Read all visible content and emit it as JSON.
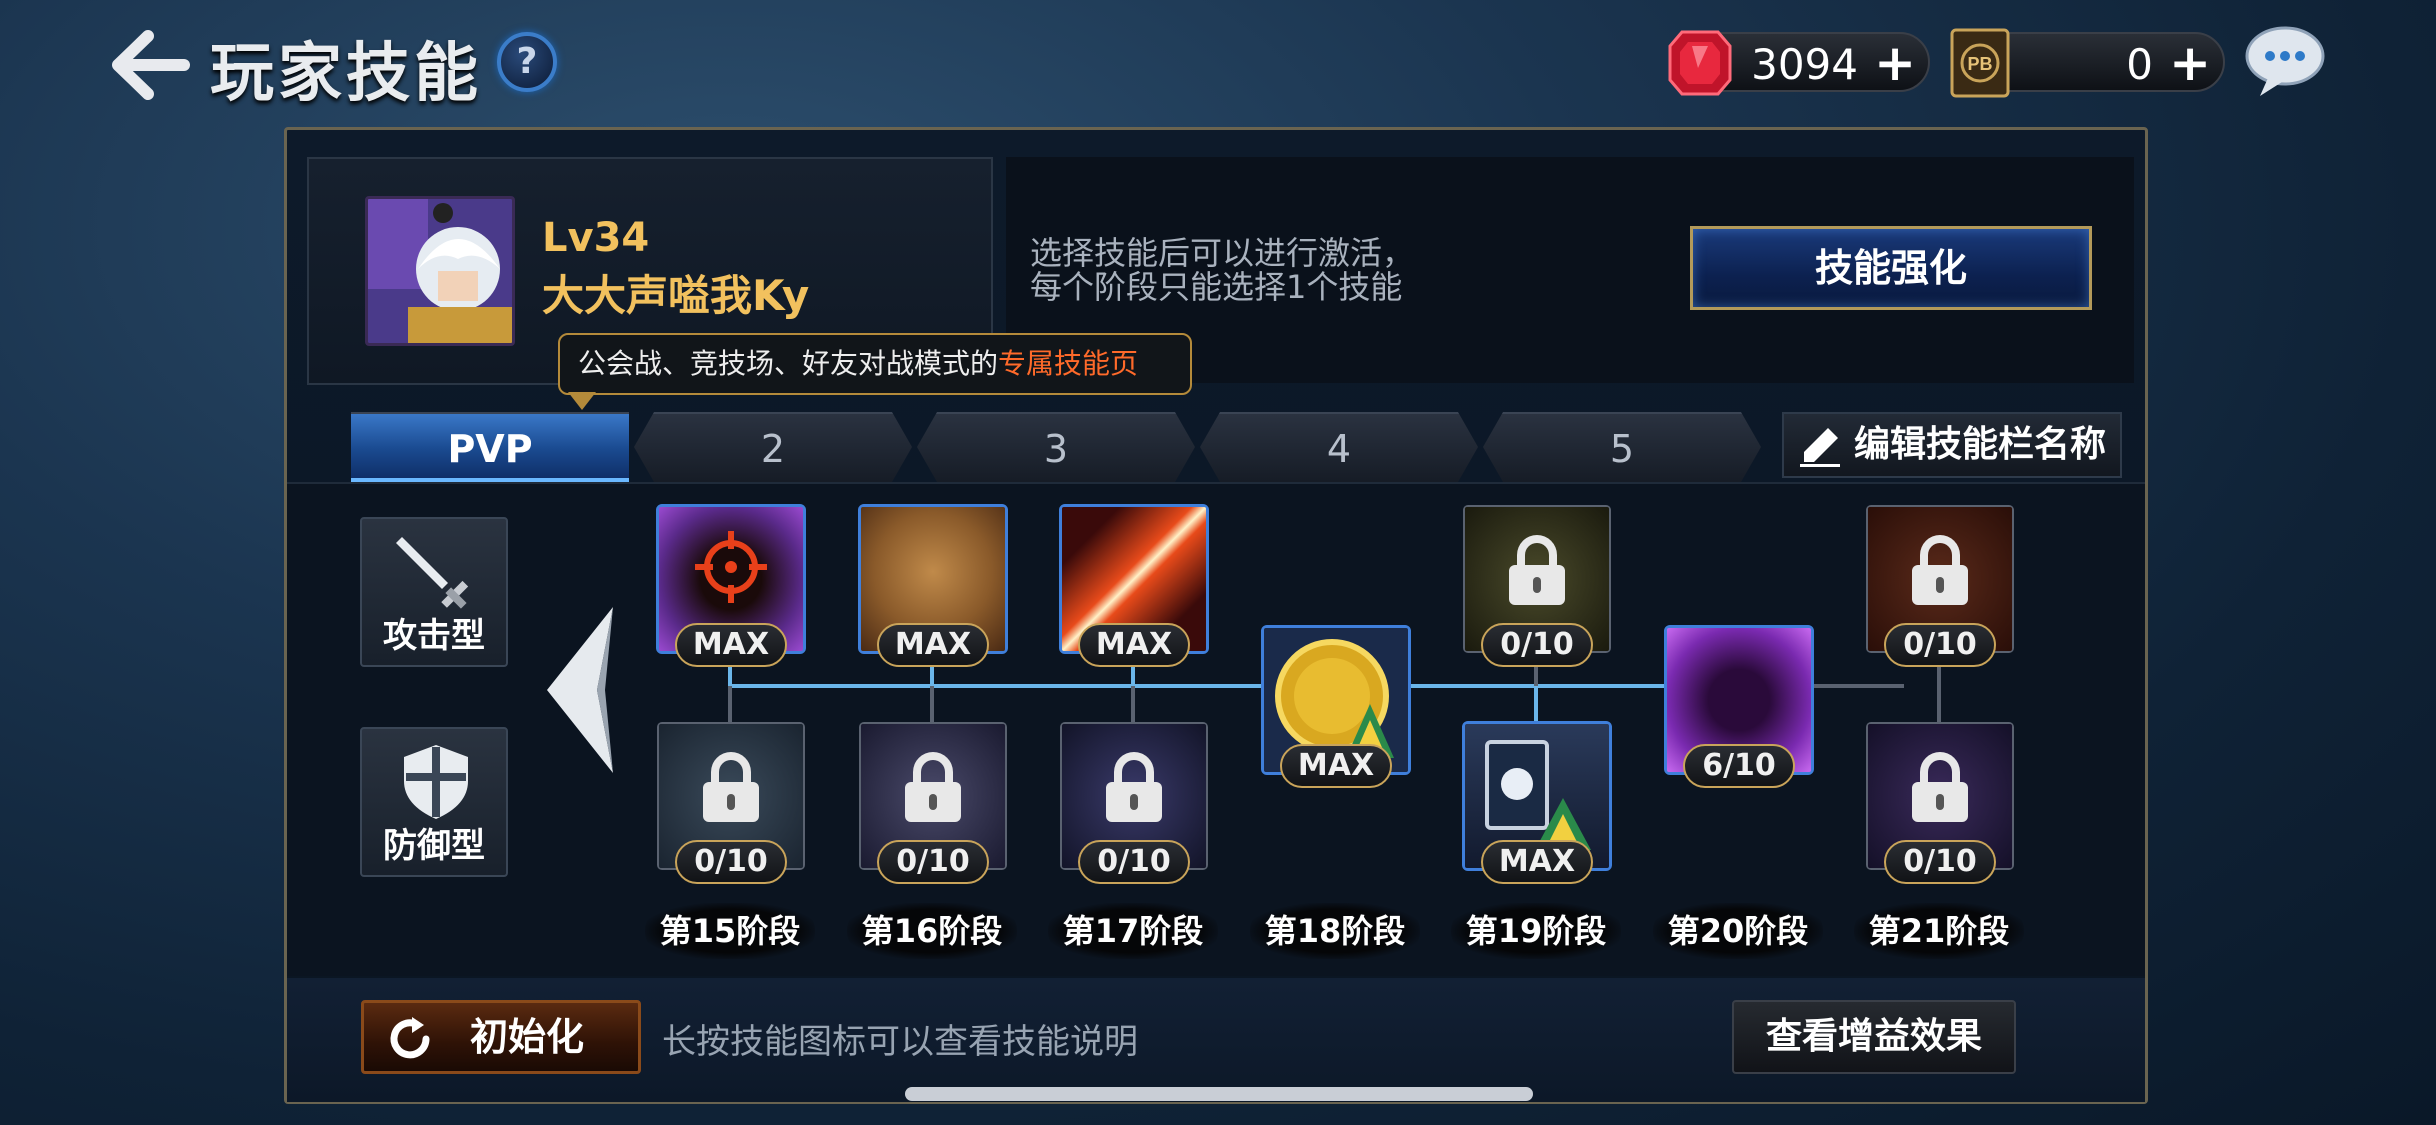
{
  "header": {
    "title": "玩家技能",
    "help_label": "?",
    "currencies": [
      {
        "icon": "ruby-gem-icon",
        "value": "3094",
        "plus": "+"
      },
      {
        "icon": "pvp-ticket-icon",
        "value": "0",
        "plus": "+"
      }
    ],
    "chat_icon": "chat-bubble-icon"
  },
  "profile": {
    "level": "Lv34",
    "name": "大大声嗌我Ky"
  },
  "description": {
    "line1": "选择技能后可以进行激活，",
    "line2": "每个阶段只能选择1个技能",
    "enhance_label": "技能强化"
  },
  "tooltip": {
    "prefix": "公会战、竞技场、好友对战模式的",
    "highlight": "专属技能页"
  },
  "tabs": [
    {
      "label": "PVP",
      "active": true
    },
    {
      "label": "2",
      "active": false
    },
    {
      "label": "3",
      "active": false
    },
    {
      "label": "4",
      "active": false
    },
    {
      "label": "5",
      "active": false
    }
  ],
  "edit_label": "编辑技能栏名称",
  "types": {
    "attack": "攻击型",
    "defense": "防御型"
  },
  "stages": [
    {
      "label": "第15阶段",
      "top": {
        "badge": "MAX",
        "locked": false
      },
      "bottom": {
        "badge": "0/10",
        "locked": true
      }
    },
    {
      "label": "第16阶段",
      "top": {
        "badge": "MAX",
        "locked": false
      },
      "bottom": {
        "badge": "0/10",
        "locked": true
      }
    },
    {
      "label": "第17阶段",
      "top": {
        "badge": "MAX",
        "locked": false
      },
      "bottom": {
        "badge": "0/10",
        "locked": true
      }
    },
    {
      "label": "第18阶段",
      "middle": {
        "badge": "MAX",
        "locked": false
      }
    },
    {
      "label": "第19阶段",
      "top": {
        "badge": "0/10",
        "locked": true
      },
      "bottom": {
        "badge": "MAX",
        "locked": false
      }
    },
    {
      "label": "第20阶段",
      "middle": {
        "badge": "6/10",
        "locked": false
      }
    },
    {
      "label": "第21阶段",
      "top": {
        "badge": "0/10",
        "locked": true
      },
      "bottom": {
        "badge": "0/10",
        "locked": true
      }
    }
  ],
  "bottom": {
    "reset_label": "初始化",
    "hint": "长按技能图标可以查看技能说明",
    "buff_label": "查看增益效果"
  },
  "colors": {
    "accent_blue": "#3f7fdb",
    "gold_text": "#f2c15e",
    "highlight_red": "#ff6a2a"
  }
}
